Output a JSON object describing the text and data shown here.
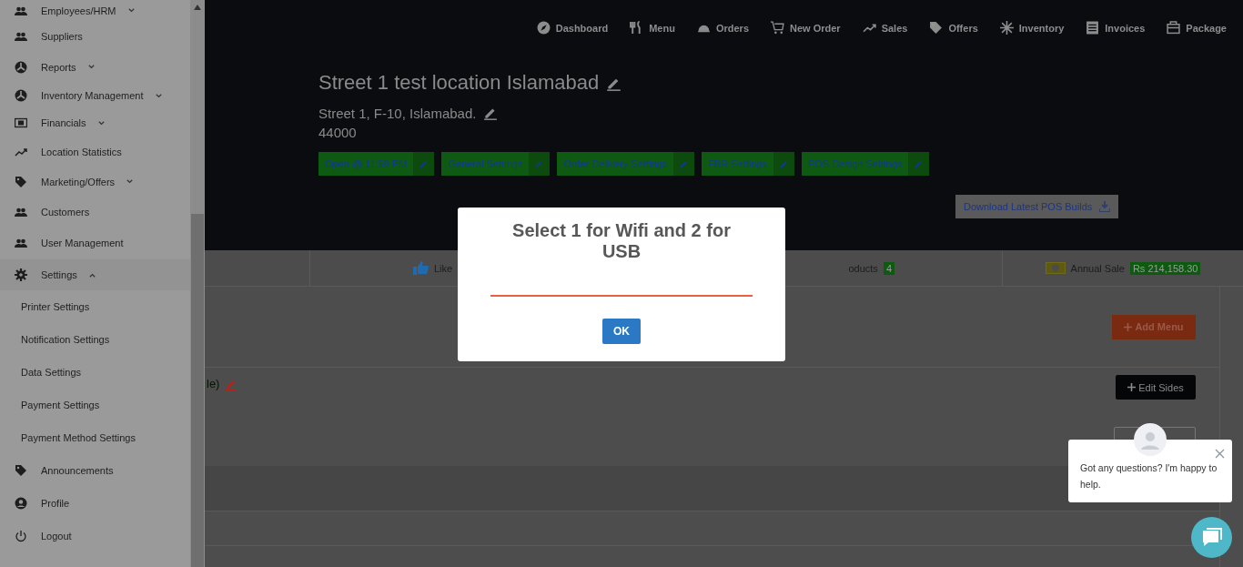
{
  "sidebar": {
    "items": [
      {
        "label": "Employees/HRM",
        "expanded": false
      },
      {
        "label": "Suppliers"
      },
      {
        "label": "Reports",
        "expanded": false
      },
      {
        "label": "Inventory Management",
        "expanded": false
      },
      {
        "label": "Financials",
        "expanded": false
      },
      {
        "label": "Location Statistics"
      },
      {
        "label": "Marketing/Offers",
        "expanded": false
      },
      {
        "label": "Customers"
      },
      {
        "label": "User Management"
      },
      {
        "label": "Settings",
        "expanded": true,
        "children": [
          {
            "label": "Printer Settings"
          },
          {
            "label": "Notification Settings"
          },
          {
            "label": "Data Settings"
          },
          {
            "label": "Payment Settings"
          },
          {
            "label": "Payment Method Settings"
          }
        ]
      },
      {
        "label": "Announcements"
      },
      {
        "label": "Profile"
      },
      {
        "label": "Logout"
      }
    ]
  },
  "nav": [
    {
      "label": "Dashboard"
    },
    {
      "label": "Menu"
    },
    {
      "label": "Orders"
    },
    {
      "label": "New Order"
    },
    {
      "label": "Sales"
    },
    {
      "label": "Offers"
    },
    {
      "label": "Inventory"
    },
    {
      "label": "Invoices"
    },
    {
      "label": "Package"
    }
  ],
  "location": {
    "title": "Street 1 test location Islamabad",
    "address": "Street 1, F-10, Islamabad.",
    "postcode": "44000",
    "settings_buttons": [
      "Open @ 11:59 PM",
      "General Settings",
      "Order Delivery Settings",
      "FBR Settings",
      "POS Design Settings"
    ],
    "download_button": "Download Latest POS Builds"
  },
  "stats": [
    {
      "kind": "empty"
    },
    {
      "kind": "likes",
      "label": "Like"
    },
    {
      "kind": "count",
      "label": "oducts",
      "badge": "4"
    },
    {
      "kind": "sale",
      "label": "Annual Sale",
      "badge": "Rs 214,158.30"
    }
  ],
  "content": {
    "add_menu_button": "Add Menu",
    "row_text": "le)",
    "edit_sides_button": "Edit Sides"
  },
  "dialog": {
    "title": "Select 1 for Wifi and 2 for USB",
    "ok_button": "OK"
  },
  "chat": {
    "message": "Got any questions? I'm happy to help."
  }
}
